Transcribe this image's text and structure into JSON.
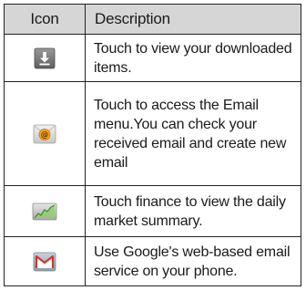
{
  "table": {
    "headers": {
      "icon": "Icon",
      "description": "Description"
    },
    "rows": [
      {
        "icon": "download-icon",
        "description": "Touch to view your downloaded items."
      },
      {
        "icon": "email-icon",
        "description": "Touch to access the Email menu.You can check your received email and create new email"
      },
      {
        "icon": "finance-chart-icon",
        "description": "Touch finance to view the daily market summary."
      },
      {
        "icon": "gmail-icon",
        "description": "Use Google's web-based email service on your phone."
      }
    ]
  },
  "colors": {
    "header_background": "#d6d6d6",
    "border": "#222222"
  }
}
